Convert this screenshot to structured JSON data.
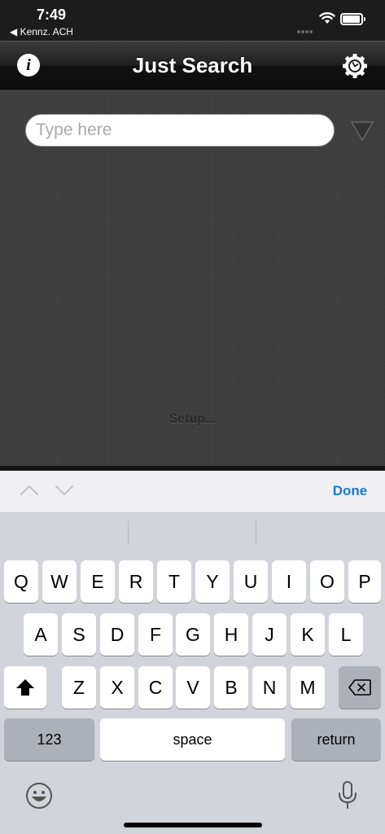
{
  "status_bar": {
    "time": "7:49",
    "back_app": "◀ Kennz. ACH"
  },
  "nav_bar": {
    "title": "Just Search",
    "info_label": "i"
  },
  "search": {
    "placeholder": "Type here",
    "value": ""
  },
  "content": {
    "setup_label": "Setup..."
  },
  "keyboard_toolbar": {
    "done_label": "Done"
  },
  "keyboard": {
    "row1": [
      "Q",
      "W",
      "E",
      "R",
      "T",
      "Y",
      "U",
      "I",
      "O",
      "P"
    ],
    "row2": [
      "A",
      "S",
      "D",
      "F",
      "G",
      "H",
      "J",
      "K",
      "L"
    ],
    "row3": [
      "Z",
      "X",
      "C",
      "V",
      "B",
      "N",
      "M"
    ],
    "numbers_label": "123",
    "space_label": "space",
    "return_label": "return"
  },
  "colors": {
    "accent": "#1779d5",
    "nav_bg": "#1c1c1c",
    "content_bg": "#3e3e3e",
    "keyboard_bg": "#d1d4da"
  },
  "icons": [
    "back-arrow-icon",
    "wifi-icon",
    "battery-icon",
    "info-icon",
    "settings-gear-icon",
    "dropdown-triangle-icon",
    "chevron-up-icon",
    "chevron-down-icon",
    "shift-icon",
    "backspace-icon",
    "emoji-icon",
    "microphone-icon"
  ]
}
